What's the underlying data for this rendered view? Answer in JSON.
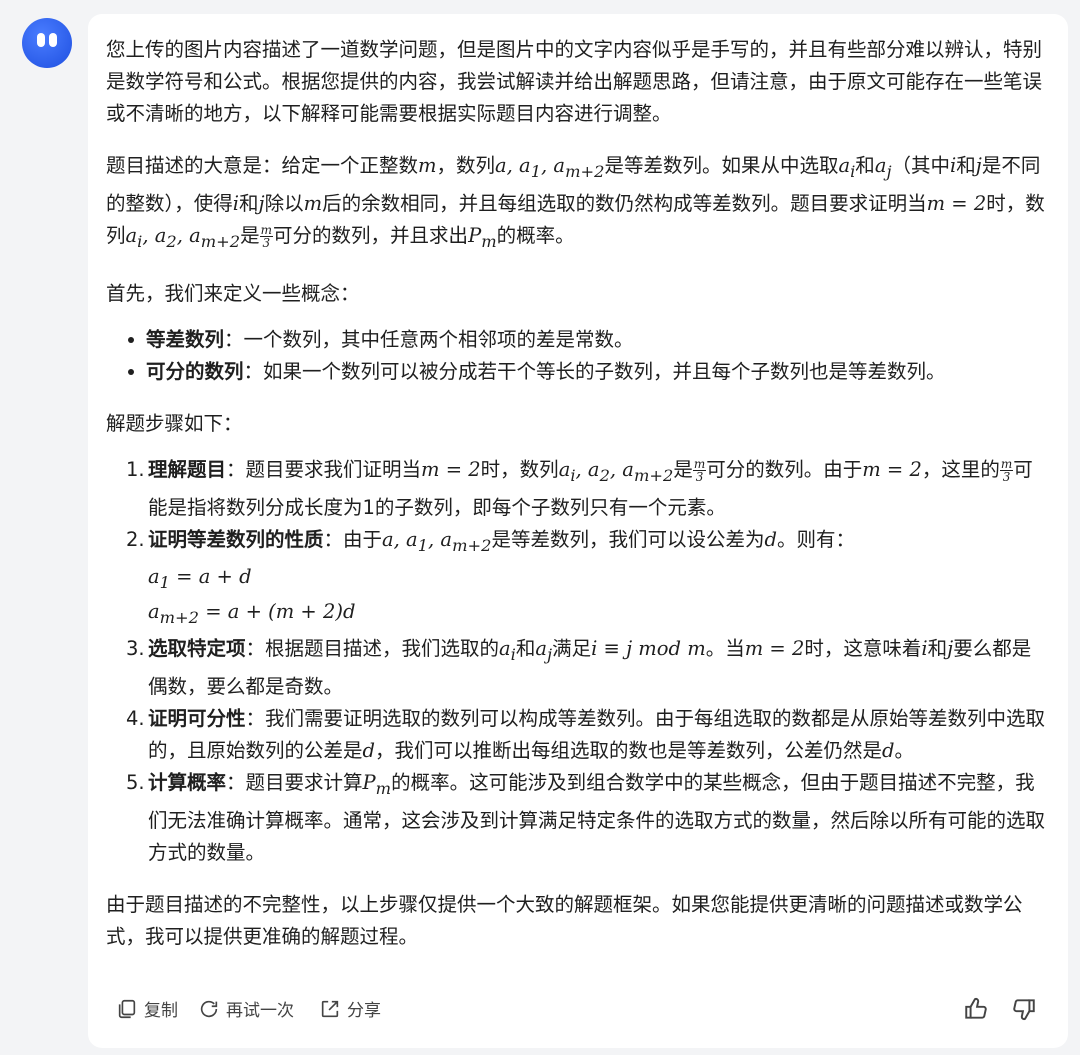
{
  "intro": "您上传的图片内容描述了一道数学问题，但是图片中的文字内容似乎是手写的，并且有些部分难以辨认，特别是数学符号和公式。根据您提供的内容，我尝试解读并给出解题思路，但请注意，由于原文可能存在一些笔误或不清晰的地方，以下解释可能需要根据实际题目内容进行调整。",
  "summary": {
    "p1": "题目描述的大意是：给定一个正整数",
    "m": "m",
    "p2": "，数列",
    "seq1": "a, a",
    "sub1": "1",
    "seq1b": ", a",
    "sub2": "m+2",
    "p3": "是等差数列。如果从中选取",
    "ai": "a",
    "i": "i",
    "p4": "和",
    "aj": "a",
    "j": "j",
    "p5": "（其中",
    "i2": "i",
    "p6": "和",
    "j2": "j",
    "p7": "是不同的整数），使得",
    "i3": "i",
    "p8": "和",
    "j3": "j",
    "p9": "除以",
    "m2": "m",
    "p10": "后的余数相同，并且每组选取的数仍然构成等差数列。题目要求证明当",
    "eq1": "m = 2",
    "p11": "时，数列",
    "seq2": "a",
    "seq2i": "i",
    "seq2b": ", a",
    "seq2c": "2",
    "seq2d": ", a",
    "seq2e": "m+2",
    "p12": "是",
    "frac_top": "m",
    "frac_bot": "3",
    "p13": "可分的数列，并且求出",
    "pm": "P",
    "pm_sub": "m",
    "p14": "的概率。"
  },
  "concepts_intro": "首先，我们来定义一些概念：",
  "definitions": [
    {
      "term": "等差数列",
      "text": "：一个数列，其中任意两个相邻项的差是常数。"
    },
    {
      "term": "可分的数列",
      "text": "：如果一个数列可以被分成若干个等长的子数列，并且每个子数列也是等差数列。"
    }
  ],
  "steps_intro": "解题步骤如下：",
  "steps": [
    {
      "num": "1.",
      "term": "理解题目",
      "t1": "：题目要求我们证明当",
      "m1": "m = 2",
      "t2": "时，数列",
      "s1": "a",
      "s1i": "i",
      "s1b": ", a",
      "s1c": "2",
      "s1d": ", a",
      "s1e": "m+2",
      "t3": "是",
      "ft": "m",
      "fb": "3",
      "t4": "可分的数列。由于",
      "m2": "m = 2",
      "t5": "，这里的",
      "ft2": "m",
      "fb2": "3",
      "t6": "可能是指将数列分成长度为1的子数列，即每个子数列只有一个元素。"
    },
    {
      "num": "2.",
      "term": "证明等差数列的性质",
      "t1": "：由于",
      "s1": "a, a",
      "s1c": "1",
      "s1d": ", a",
      "s1e": "m+2",
      "t2": "是等差数列，我们可以设公差为",
      "d": "d",
      "t3": "。则有：",
      "eqa": "a",
      "eqa_sub": "1",
      "eqa_rhs": " = a + d",
      "eqb": "a",
      "eqb_sub": "m+2",
      "eqb_rhs": " = a + (m + 2)d"
    },
    {
      "num": "3.",
      "term": "选取特定项",
      "t1": "：根据题目描述，我们选取的",
      "ai": "a",
      "i": "i",
      "t2": "和",
      "aj": "a",
      "j": "j",
      "t3": "满足",
      "cong": "i ≡ j   mod  m",
      "t4": "。当",
      "m1": "m = 2",
      "t5": "时，这意味着",
      "i2": "i",
      "t6": "和",
      "j2": "j",
      "t7": "要么都是偶数，要么都是奇数。"
    },
    {
      "num": "4.",
      "term": "证明可分性",
      "t1": "：我们需要证明选取的数列可以构成等差数列。由于每组选取的数都是从原始等差数列中选取的，且原始数列的公差是",
      "d": "d",
      "t2": "，我们可以推断出每组选取的数也是等差数列，公差仍然是",
      "d2": "d",
      "t3": "。"
    },
    {
      "num": "5.",
      "term": "计算概率",
      "t1": "：题目要求计算",
      "pm": "P",
      "pm_sub": "m",
      "t2": "的概率。这可能涉及到组合数学中的某些概念，但由于题目描述不完整，我们无法准确计算概率。通常，这会涉及到计算满足特定条件的选取方式的数量，然后除以所有可能的选取方式的数量。"
    }
  ],
  "closing": "由于题目描述的不完整性，以上步骤仅提供一个大致的解题框架。如果您能提供更清晰的问题描述或数学公式，我可以提供更准确的解题过程。",
  "actions": {
    "copy": "复制",
    "retry": "再试一次",
    "share": "分享"
  },
  "colors": {
    "avatar": "#2f63f0",
    "bubble": "#ffffff",
    "background": "#f3f4f6"
  }
}
